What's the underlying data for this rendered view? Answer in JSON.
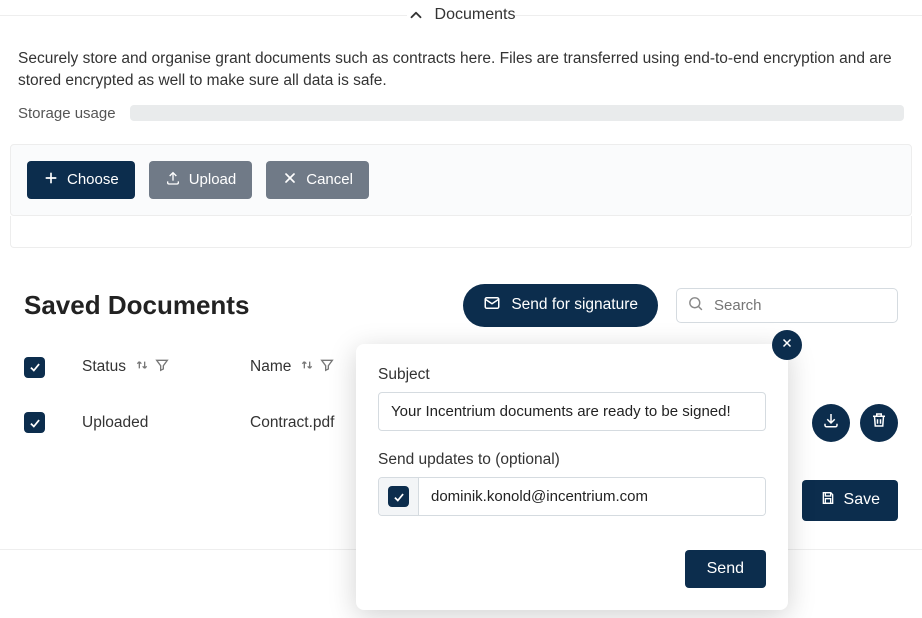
{
  "header": {
    "title": "Documents"
  },
  "description": "Securely store and organise grant documents such as contracts here. Files are transferred using end-to-end encryption and are stored encrypted as well to make sure all data is safe.",
  "storage": {
    "label": "Storage usage"
  },
  "upload_panel": {
    "choose": "Choose",
    "upload": "Upload",
    "cancel": "Cancel"
  },
  "saved": {
    "title": "Saved Documents",
    "send_button": "Send for signature",
    "search_placeholder": "Search",
    "columns": {
      "status": "Status",
      "name": "Name"
    },
    "rows": [
      {
        "status": "Uploaded",
        "name": "Contract.pdf"
      }
    ]
  },
  "popover": {
    "subject_label": "Subject",
    "subject_value": "Your Incentrium documents are ready to be signed!",
    "updates_label": "Send updates to (optional)",
    "email_value": "dominik.konold@incentrium.com",
    "send": "Send"
  },
  "page": {
    "save": "Save"
  }
}
